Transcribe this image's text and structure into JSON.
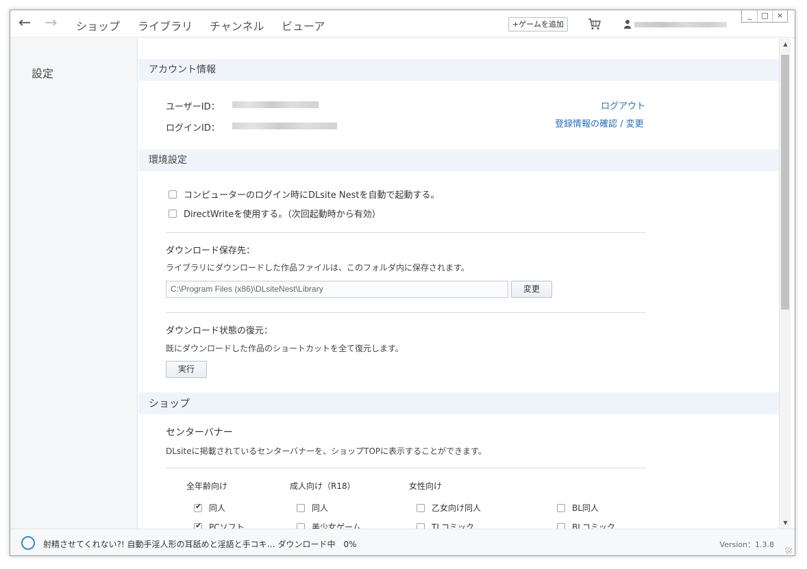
{
  "nav": {
    "back_icon": "arrow-left",
    "forward_icon": "arrow-right",
    "links": [
      "ショップ",
      "ライブラリ",
      "チャンネル",
      "ビューア"
    ],
    "add_game": "+ゲームを追加",
    "cart_icon": "cart",
    "user_icon": "user"
  },
  "window_controls": {
    "minimize": "_",
    "maximize": "□",
    "close": "×"
  },
  "sidebar": {
    "title": "設定"
  },
  "account": {
    "header": "アカウント情報",
    "user_id_label": "ユーザーID：",
    "login_id_label": "ログインID：",
    "logout": "ログアウト",
    "verify_link": "登録情報の確認 / 変更"
  },
  "env": {
    "header": "環境設定",
    "options": [
      {
        "label": "コンピューターのログイン時にDLsite Nestを自動で起動する。",
        "checked": false
      },
      {
        "label": "DirectWriteを使用する。（次回起動時から有効）",
        "checked": false
      }
    ],
    "download_dest_title": "ダウンロード保存先：",
    "download_dest_desc": "ライブラリにダウンロードした作品ファイルは、このフォルダ内に保存されます。",
    "path_value": "C:\\Program Files (x86)\\DLsiteNest\\Library",
    "change_button": "変更",
    "restore_title": "ダウンロード状態の復元：",
    "restore_desc": "既にダウンロードした作品のショートカットを全て復元します。",
    "run_button": "実行"
  },
  "shop": {
    "header": "ショップ",
    "banner_title": "センターバナー",
    "banner_desc": "DLsiteに掲載されているセンターバナーを、ショップTOPに表示することができます。",
    "columns": [
      "全年齢向け",
      "成人向け（R18）",
      "女性向け"
    ],
    "options": [
      {
        "label": "同人",
        "checked": true
      },
      {
        "label": "同人",
        "checked": false
      },
      {
        "label": "乙女向け同人",
        "checked": false
      },
      {
        "label": "BL同人",
        "checked": false
      },
      {
        "label": "PCソフト",
        "checked": true
      },
      {
        "label": "美少女ゲーム",
        "checked": false
      },
      {
        "label": "TLコミック",
        "checked": false
      },
      {
        "label": "BLコミック",
        "checked": false
      }
    ]
  },
  "scrollbar": {
    "up_icon": "▲",
    "down_icon": "▼"
  },
  "status": {
    "text": "射精させてくれない?! 自動手淫人形の耳舐めと淫語と手コキ…  ダウンロード中　0%",
    "progress": 0,
    "version": "Version：1.3.8"
  },
  "colors": {
    "link": "#2a6fb8",
    "section_bg": "#eff4fa",
    "spinner": "#3b86c8"
  }
}
